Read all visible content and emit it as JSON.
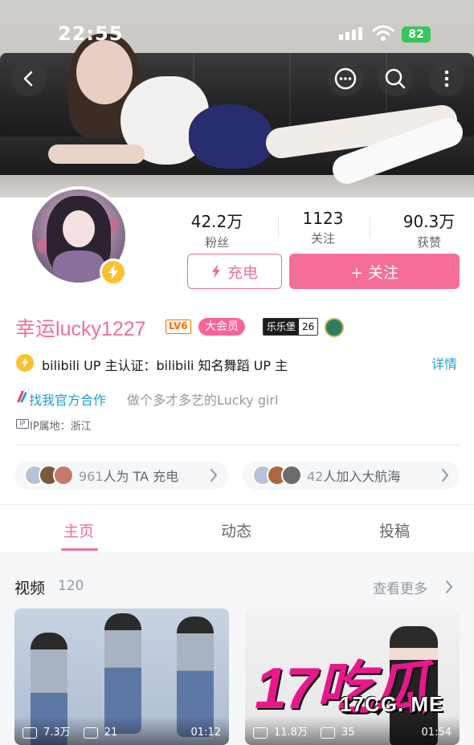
{
  "status_bar": {
    "time": "22:55",
    "battery": "82"
  },
  "profile": {
    "stats": [
      {
        "num": "42.2万",
        "label": "粉丝"
      },
      {
        "num": "1123",
        "label": "关注"
      },
      {
        "num": "90.3万",
        "label": "获赞"
      }
    ],
    "charge_label": "充电",
    "follow_label": "+ 关注",
    "username": "幸运lucky1227",
    "level_badge": "LV6",
    "vip_badge": "大会员",
    "fan_badge": {
      "name": "乐乐堡",
      "level": "26"
    },
    "verify_text": "bilibili UP 主认证：bilibili 知名舞蹈 UP 主",
    "detail_link": "详情",
    "coop_link": "找我官方合作",
    "signature": "做个多才多艺的Lucky girl",
    "ip_location": "IP属地：浙江"
  },
  "supporters": [
    {
      "count": "961",
      "text": "人为 TA 充电"
    },
    {
      "count": "42",
      "text": "人加入大航海"
    }
  ],
  "tabs": [
    "主页",
    "动态",
    "投稿"
  ],
  "videos_section": {
    "title": "视频",
    "count": "120",
    "more_label": "查看更多",
    "cards": [
      {
        "views": "7.3万",
        "danmaku": "21",
        "duration": "01:12"
      },
      {
        "views": "11.8万",
        "danmaku": "35",
        "duration": "01:54"
      }
    ]
  },
  "watermark": {
    "big": "17吃瓜",
    "small": "17CG. ME"
  },
  "colors": {
    "brand_pink": "#f06e97",
    "link_blue": "#1ea1d4",
    "battery_green": "#34c759"
  }
}
